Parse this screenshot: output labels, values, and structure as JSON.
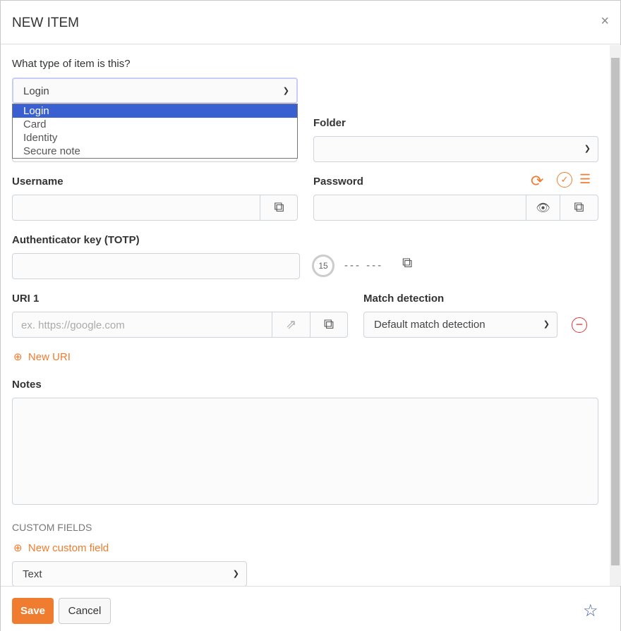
{
  "title": "NEW ITEM",
  "type_label": "What type of item is this?",
  "type_value": "Login",
  "type_options": [
    "Login",
    "Card",
    "Identity",
    "Secure note"
  ],
  "folder_label": "Folder",
  "username_label": "Username",
  "password_label": "Password",
  "totp_label": "Authenticator key (TOTP)",
  "totp_countdown": "15",
  "totp_code": "--- ---",
  "uri_label": "URI 1",
  "uri_placeholder": "ex. https://google.com",
  "match_label": "Match detection",
  "match_value": "Default match detection",
  "new_uri": "New URI",
  "notes_label": "Notes",
  "custom_fields_label": "CUSTOM FIELDS",
  "new_custom_field": "New custom field",
  "custom_type_value": "Text",
  "save": "Save",
  "cancel": "Cancel",
  "colors": {
    "accent": "#f07c2f",
    "selected_option": "#3a5fd1"
  }
}
